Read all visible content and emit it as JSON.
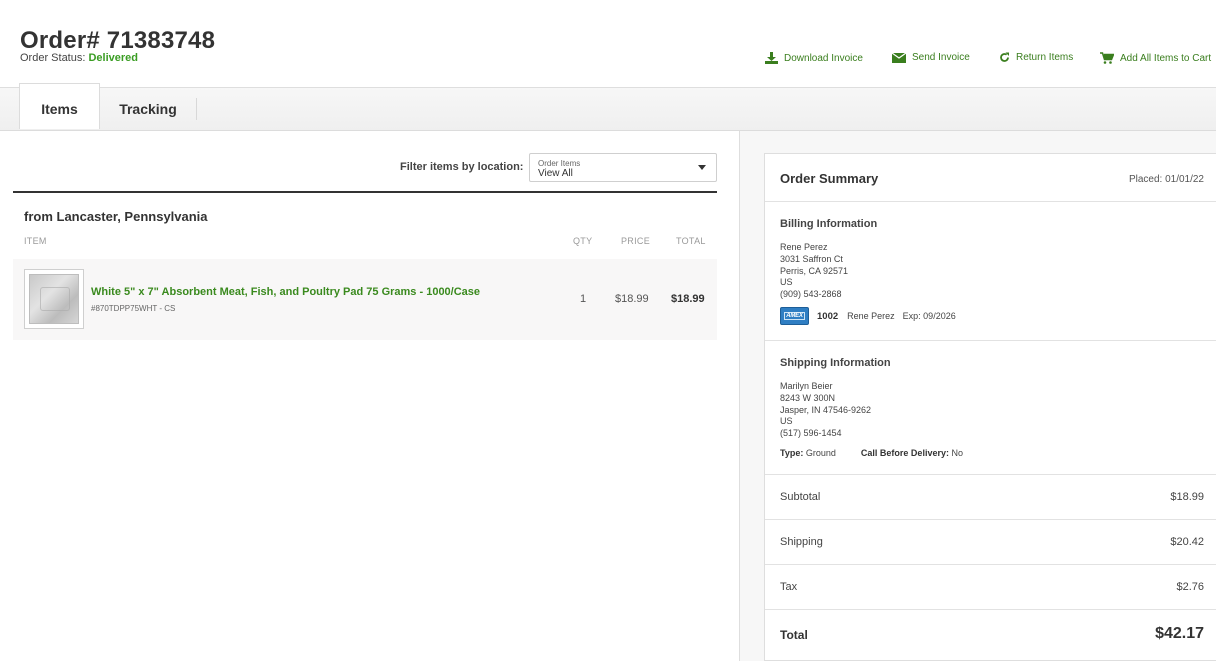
{
  "order": {
    "title": "Order# 71383748",
    "status_label": "Order Status:",
    "status_value": "Delivered"
  },
  "actions": {
    "download_invoice": "Download Invoice",
    "send_invoice": "Send Invoice",
    "return_items": "Return Items",
    "add_all_to_cart": "Add All Items to Cart"
  },
  "tabs": {
    "items": "Items",
    "tracking": "Tracking"
  },
  "filter": {
    "label": "Filter items by location:",
    "select_caption": "Order Items",
    "select_value": "View All"
  },
  "items_section": {
    "location_heading": "from Lancaster, Pennsylvania",
    "columns": {
      "item": "ITEM",
      "qty": "QTY",
      "price": "PRICE",
      "total": "TOTAL"
    },
    "rows": [
      {
        "name": "White 5\" x 7\" Absorbent Meat, Fish, and Poultry Pad 75 Grams - 1000/Case",
        "sku": "#870TDPP75WHT - CS",
        "qty": "1",
        "price": "$18.99",
        "total": "$18.99"
      }
    ]
  },
  "summary": {
    "title": "Order Summary",
    "placed": "Placed: 01/01/22",
    "billing": {
      "title": "Billing Information",
      "name": "Rene Perez",
      "street": "3031 Saffron Ct",
      "city": "Perris, CA 92571",
      "country": "US",
      "phone": "(909) 543-2868",
      "card_brand_text": "AMEX",
      "card_last4": "1002",
      "card_holder": "Rene Perez",
      "card_exp": "Exp: 09/2026"
    },
    "shipping": {
      "title": "Shipping Information",
      "name": "Marilyn Beier",
      "street": "8243 W 300N",
      "city": "Jasper, IN 47546-9262",
      "country": "US",
      "phone": "(517) 596-1454",
      "type_label": "Type:",
      "type_value": "Ground",
      "call_label": "Call Before Delivery:",
      "call_value": "No"
    },
    "subtotal_label": "Subtotal",
    "subtotal": "$18.99",
    "shipping_label": "Shipping",
    "shipping_cost": "$20.42",
    "tax_label": "Tax",
    "tax": "$2.76",
    "total_label": "Total",
    "total": "$42.17"
  },
  "colors": {
    "accent_green": "#3a8a1e",
    "status_green": "#3a9d23",
    "amex_blue": "#2f7ec3"
  }
}
